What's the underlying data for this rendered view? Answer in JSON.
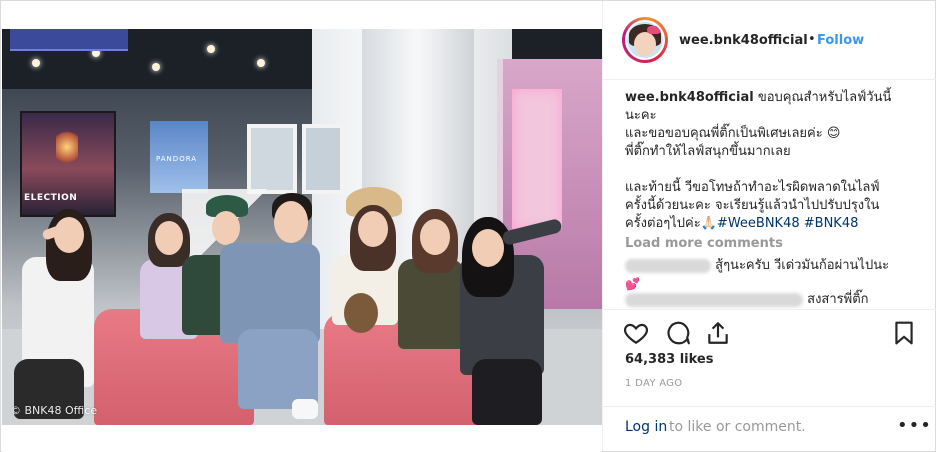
{
  "post": {
    "watermark": "© BNK48 Office",
    "poster_text": "ELECTION",
    "screen_label": "PANDORA"
  },
  "header": {
    "username": "wee.bnk48official",
    "separator": "•",
    "follow_label": "Follow"
  },
  "caption": {
    "username": "wee.bnk48official",
    "lines": [
      "ขอบคุณสำหรับไลฟ์วันนี้",
      "นะคะ",
      "และขอขอบคุณพี่ติ๊กเป็นพิเศษเลยค่ะ 😊",
      "พี่ติ๊กทำให้ไลฟ์สนุกขึ้นมากเลย",
      "",
      "และท้ายนี้ วีขอโทษถ้าทำอะไรผิดพลาดในไลฟ์",
      "ครั้งนี้ด้วยนะคะ จะเรียนรู้แล้วนำไปปรับปรุงใน",
      "ครั้งต่อๆไปค่ะ🙏🏻"
    ],
    "hashtags": [
      "#WeeBNK48",
      "#BNK48"
    ]
  },
  "load_more": "Load more comments",
  "comments": [
    {
      "text": "สู้ๆนะครับ วีเด่วมันก้อผ่านไปนะ",
      "extra": "💕"
    },
    {
      "text": "สงสารพี่ติ๊ก"
    }
  ],
  "actions": {
    "like_icon": "heart-icon",
    "comment_icon": "comment-bubble-icon",
    "share_icon": "share-icon",
    "save_icon": "bookmark-icon"
  },
  "likes": "64,383 likes",
  "time_ago": "1 DAY AGO",
  "login": {
    "link": "Log in",
    "rest": " to like or comment.",
    "more": "•••"
  },
  "colors": {
    "link_blue": "#3897f0",
    "hashtag_blue": "#003569",
    "muted": "#999999",
    "text": "#262626"
  }
}
